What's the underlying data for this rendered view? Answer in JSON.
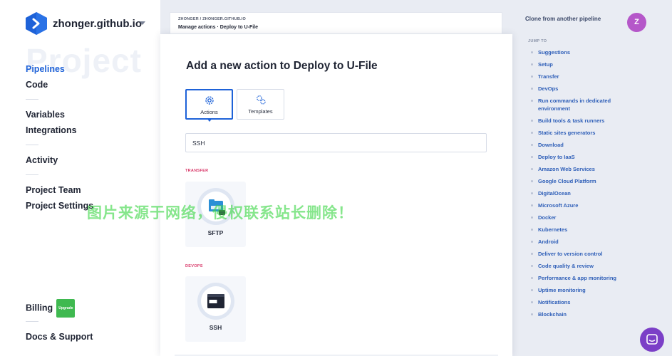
{
  "app": {
    "name": "zhonger.github.io",
    "watermark": "Project"
  },
  "sidebar": {
    "groups": [
      [
        "Pipelines",
        "Code"
      ],
      [
        "Variables",
        "Integrations"
      ],
      [
        "Activity"
      ],
      [
        "Project Team",
        "Project Settings"
      ]
    ],
    "billing_label": "Billing",
    "upgrade_badge": "Upgrade",
    "docs_label": "Docs & Support"
  },
  "breadcrumb": {
    "line1": "ZHONGER / ZHONGER.GITHUB.IO",
    "line2_prefix": "Manage actions · ",
    "line2_target": "Deploy to U-File"
  },
  "modal": {
    "title": "Add a new action to Deploy to U-File",
    "tabs": [
      "Actions",
      "Templates"
    ],
    "active_tab": "Actions",
    "search_value": "SSH",
    "sections": [
      {
        "label": "TRANSFER",
        "action": "SFTP",
        "icon": "sftp-folder-icon"
      },
      {
        "label": "DEVOPS",
        "action": "SSH",
        "icon": "ssh-terminal-icon"
      }
    ]
  },
  "right_panel": {
    "clone_link": "Clone from another pipeline",
    "avatar_initial": "Z",
    "jump_label": "JUMP TO",
    "jump_items": [
      "Suggestions",
      "Setup",
      "Transfer",
      "DevOps",
      "Run commands in dedicated environment",
      "Build tools & task runners",
      "Static sites generators",
      "Download",
      "Deploy to IaaS",
      "Amazon Web Services",
      "Google Cloud Platform",
      "DigitalOcean",
      "Microsoft Azure",
      "Docker",
      "Kubernetes",
      "Android",
      "Deliver to version control",
      "Code quality & review",
      "Performance & app monitoring",
      "Uptime monitoring",
      "Notifications",
      "Blockchain"
    ]
  },
  "overlay_text": "图片来源于网络，侵权联系站长删除！",
  "colors": {
    "accent": "#1e62d8",
    "avatar": "#b557c9",
    "chat": "#7b3fc7",
    "section_label": "#d93a6a",
    "link": "#2f5fb8"
  }
}
